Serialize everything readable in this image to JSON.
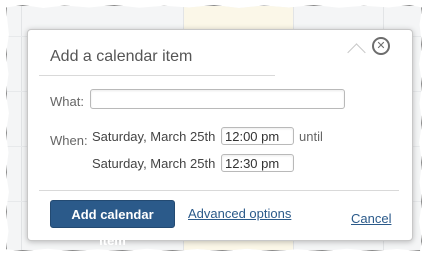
{
  "dialog": {
    "title": "Add a calendar item",
    "close_icon": "close-circle-icon"
  },
  "form": {
    "what_label": "What:",
    "what_value": "",
    "when_label": "When:",
    "start_date": "Saturday, March 25th",
    "start_time": "12:00 pm",
    "until_label": "until",
    "end_date": "Saturday, March 25th",
    "end_time": "12:30 pm"
  },
  "actions": {
    "add_label": "Add calendar item",
    "advanced_label": "Advanced options",
    "cancel_label": "Cancel"
  },
  "colors": {
    "primary": "#2b5a8a",
    "link": "#2b5a8a",
    "background_tint": "#fbf7e8"
  }
}
